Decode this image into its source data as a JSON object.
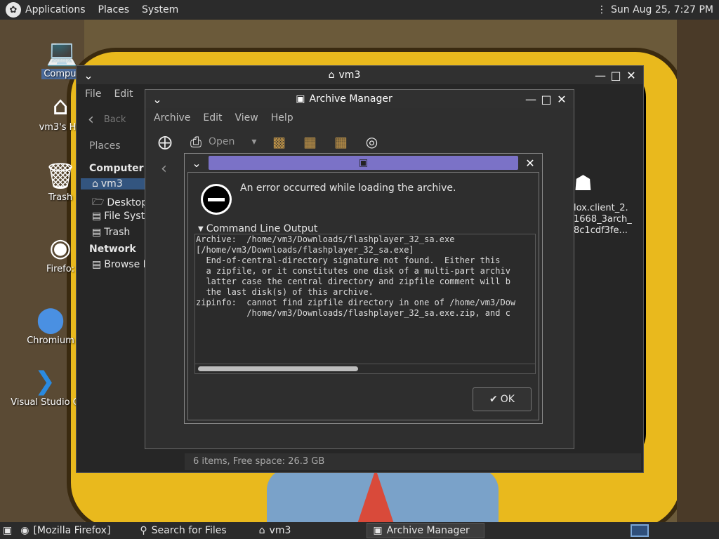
{
  "top_panel": {
    "applications": "Applications",
    "places": "Places",
    "system": "System",
    "clock": "Sun Aug 25,  7:27 PM"
  },
  "desktop_icons": {
    "computer": "Comput",
    "home": "vm3's Ho",
    "trash": "Trash",
    "firefox": "Firefo:",
    "chromium": "Chromium",
    "vscode": "Visual Studio C"
  },
  "file_manager": {
    "title": "vm3",
    "menu": [
      "File",
      "Edit",
      "V"
    ],
    "back_label": "Back",
    "places_label": "Places",
    "sidebar": {
      "computer_header": "Computer",
      "items": [
        "vm3",
        "Desktop",
        "File Syste",
        "Trash"
      ],
      "network_header": "Network",
      "network_items": [
        "Browse N"
      ]
    },
    "file_label_lines": [
      "lox.client_2.",
      "1668_3arch_",
      "8c1cdf3fe..."
    ],
    "status": "6 items, Free space: 26.3 GB"
  },
  "archive_manager": {
    "title": "Archive Manager",
    "menu": [
      "Archive",
      "Edit",
      "View",
      "Help"
    ],
    "open_label": "Open"
  },
  "error_dialog": {
    "message": "An error occurred while loading the archive.",
    "cli_header": "Command Line Output",
    "cli_output": "Archive:  /home/vm3/Downloads/flashplayer_32_sa.exe\n[/home/vm3/Downloads/flashplayer_32_sa.exe]\n  End-of-central-directory signature not found.  Either this\n  a zipfile, or it constitutes one disk of a multi-part archiv\n  latter case the central directory and zipfile comment will b\n  the last disk(s) of this archive.\nzipinfo:  cannot find zipfile directory in one of /home/vm3/Dow\n          /home/vm3/Downloads/flashplayer_32_sa.exe.zip, and c",
    "ok_label": "OK"
  },
  "taskbar": {
    "items": [
      "[Mozilla Firefox]",
      "Search for Files",
      "vm3",
      "Archive Manager"
    ]
  },
  "colors": {
    "panel": "#2b2b2b",
    "dialog_title_bar": "#7b72c7",
    "selection": "#33557f"
  }
}
